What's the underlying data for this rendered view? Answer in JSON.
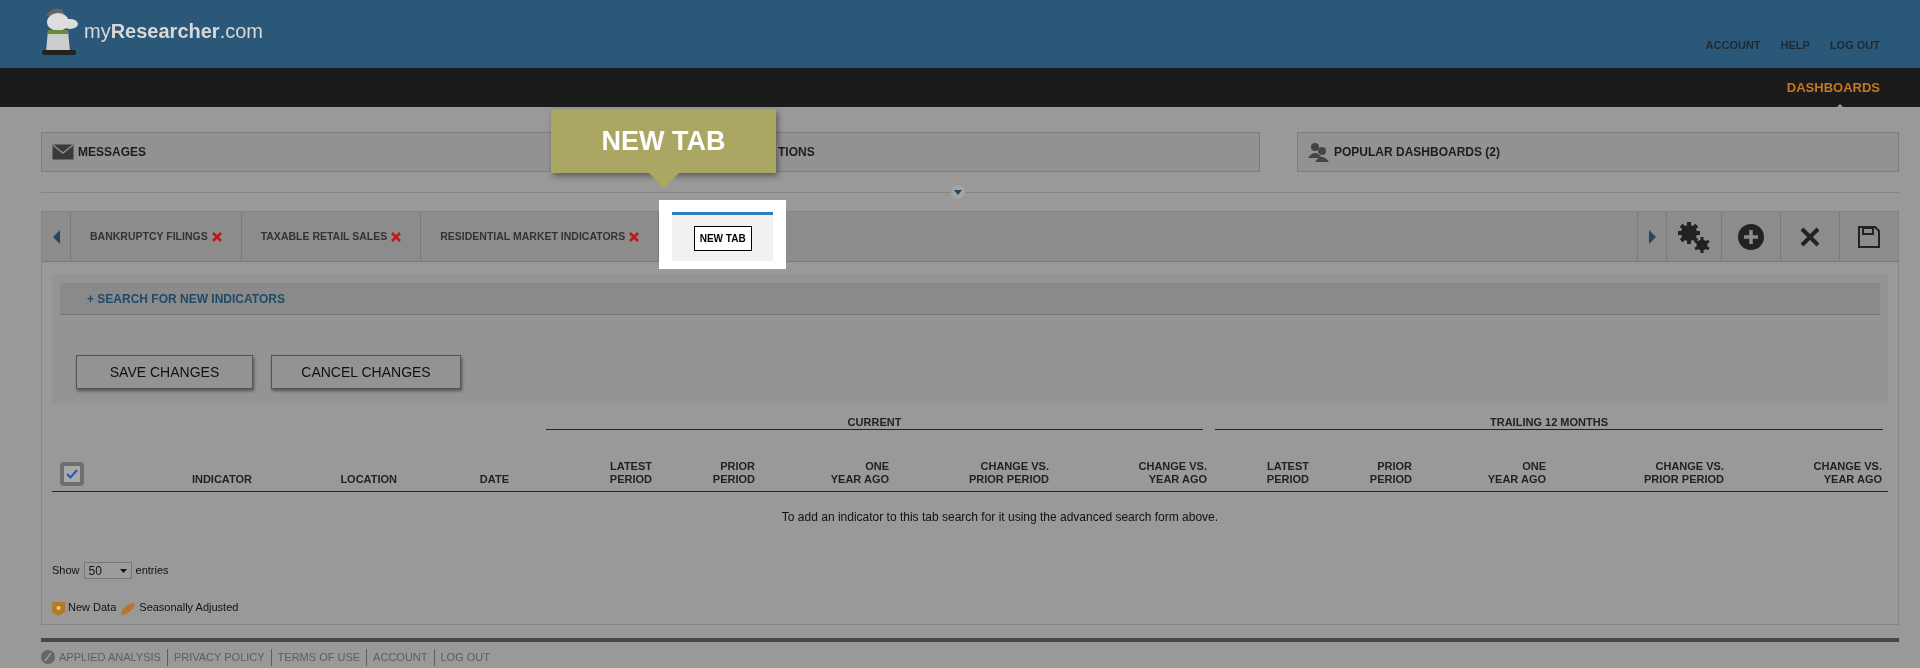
{
  "header": {
    "logo": "my**Researcher**.com",
    "links": [
      "ACCOUNT",
      "HELP",
      "LOG OUT"
    ]
  },
  "nav": {
    "items": [
      {
        "label": "DASHBOARDS",
        "selected": true
      }
    ]
  },
  "panels": [
    {
      "kind": "messages",
      "label": "MESSAGES"
    },
    {
      "kind": "plain",
      "label": "TIONS"
    },
    {
      "kind": "popular",
      "label": "POPULAR DASHBOARDS (2)"
    }
  ],
  "tabs": [
    {
      "label": "BANKRUPTCY FILINGS",
      "selected": false,
      "closable": true
    },
    {
      "label": "TAXABLE RETAIL SALES",
      "selected": false,
      "closable": true
    },
    {
      "label": "RESIDENTIAL MARKET INDICATORS",
      "selected": false,
      "closable": true
    },
    {
      "label": "NEW TAB",
      "selected": true,
      "closable": false
    }
  ],
  "callout": "NEW TAB",
  "search_link": "+ SEARCH FOR NEW INDICATORS",
  "buttons": [
    "SAVE CHANGES",
    "CANCEL CHANGES"
  ],
  "table": {
    "select_all": {
      "checked": true
    },
    "groups": [
      "CURRENT",
      "TRAILING 12 MONTHS"
    ],
    "columns": [
      "INDICATOR",
      "LOCATION",
      "DATE",
      "LATEST\nPERIOD",
      "PRIOR\nPERIOD",
      "ONE\nYEAR AGO",
      "CHANGE VS.\nPRIOR PERIOD",
      "CHANGE VS.\nYEAR AGO",
      "LATEST\nPERIOD",
      "PRIOR\nPERIOD",
      "ONE\nYEAR AGO",
      "CHANGE VS.\nPRIOR PERIOD",
      "CHANGE VS.\nYEAR AGO"
    ],
    "empty_message": "To add an indicator to this tab search for it using the advanced search form above."
  },
  "entries": {
    "before": "Show",
    "value": "50",
    "after": "entries"
  },
  "legend": [
    {
      "kind": "new",
      "label": "New Data"
    },
    {
      "kind": "seasonal",
      "label": "Seasonally Adjusted"
    }
  ],
  "footer": {
    "links": [
      "APPLIED ANALYSIS",
      "PRIVACY POLICY",
      "TERMS OF USE",
      "ACCOUNT",
      "LOG OUT"
    ]
  }
}
